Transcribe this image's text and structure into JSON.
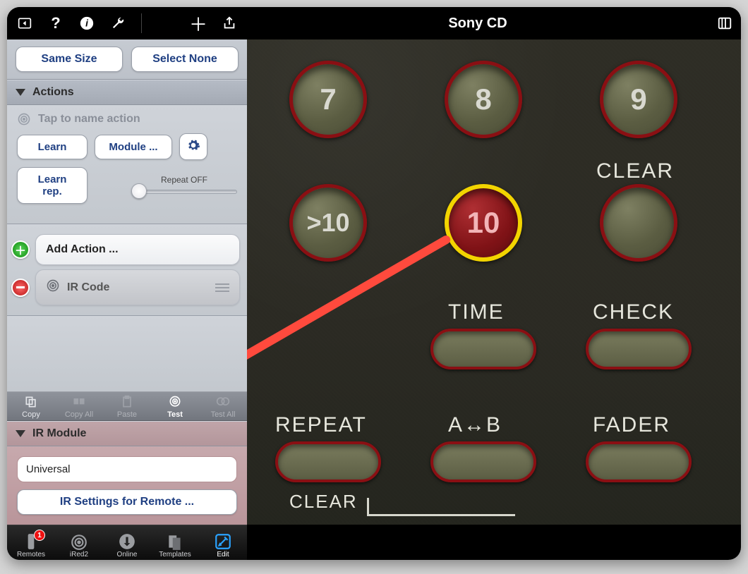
{
  "header": {
    "title": "Sony CD"
  },
  "sidebar": {
    "top_buttons": {
      "same_size": "Same Size",
      "select_none": "Select None"
    },
    "actions": {
      "section_title": "Actions",
      "hint": "Tap to name action",
      "learn": "Learn",
      "module": "Module ...",
      "learn_rep": "Learn rep.",
      "repeat_label": "Repeat OFF",
      "add_action": "Add Action ...",
      "ir_code": "IR Code"
    },
    "mini_toolbar": {
      "copy": "Copy",
      "copy_all": "Copy All",
      "paste": "Paste",
      "test": "Test",
      "test_all": "Test All"
    },
    "ir_module": {
      "section_title": "IR Module",
      "value": "Universal",
      "settings_btn": "IR Settings for Remote ..."
    }
  },
  "tabs": {
    "remotes": "Remotes",
    "remotes_badge": "1",
    "ired2": "iRed2",
    "online": "Online",
    "templates": "Templates",
    "edit": "Edit"
  },
  "remote": {
    "labels": {
      "clear": "CLEAR",
      "time": "TIME",
      "check": "CHECK",
      "repeat": "REPEAT",
      "ab": "A↔B",
      "fader": "FADER",
      "clear2": "CLEAR"
    },
    "buttons": {
      "b7": "7",
      "b8": "8",
      "b9": "9",
      "gt10": ">10",
      "b10": "10"
    }
  }
}
